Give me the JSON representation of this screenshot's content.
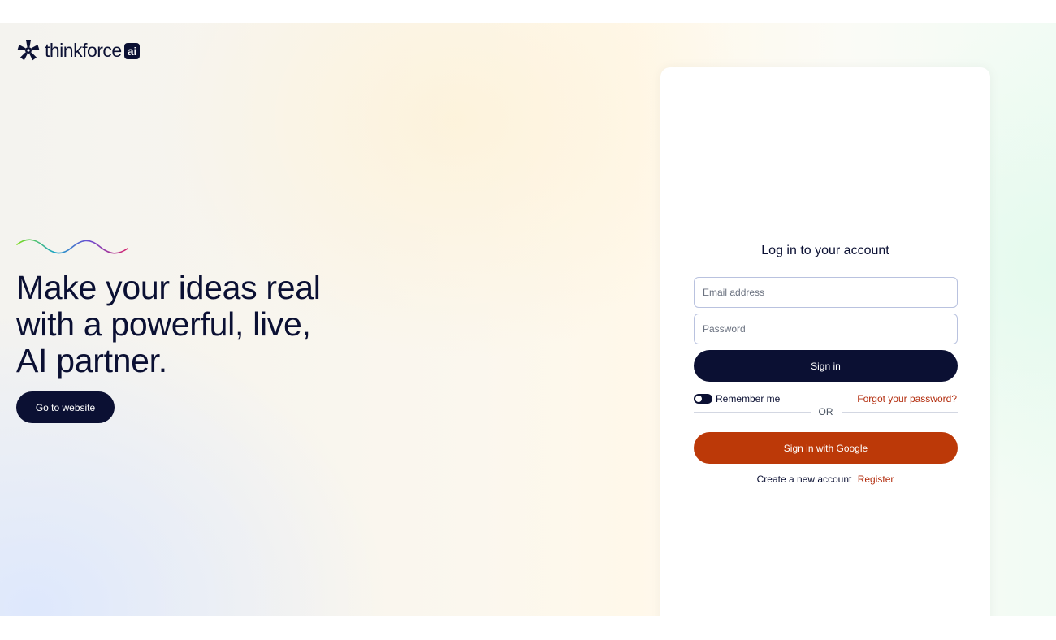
{
  "brand": {
    "name": "thinkforce",
    "badge": "ai",
    "logo_icon": "thinkforce-logo-icon",
    "colors": {
      "navy": "#0b1033",
      "accent_red": "#bc3908",
      "link_red": "#b32d0e"
    }
  },
  "hero": {
    "decoration": "gradient-wave",
    "headline_lines": [
      "Make your ideas real",
      "with a powerful, live,",
      "AI partner."
    ],
    "cta_label": "Go to website"
  },
  "login": {
    "title": "Log in to your account",
    "email_placeholder": "Email address",
    "email_value": "",
    "password_placeholder": "Password",
    "password_value": "",
    "signin_label": "Sign in",
    "remember_label": "Remember me",
    "forgot_label": "Forgot your password?",
    "or_label": "OR",
    "google_label": "Sign in with Google",
    "create_text": "Create a new account",
    "register_label": "Register"
  }
}
